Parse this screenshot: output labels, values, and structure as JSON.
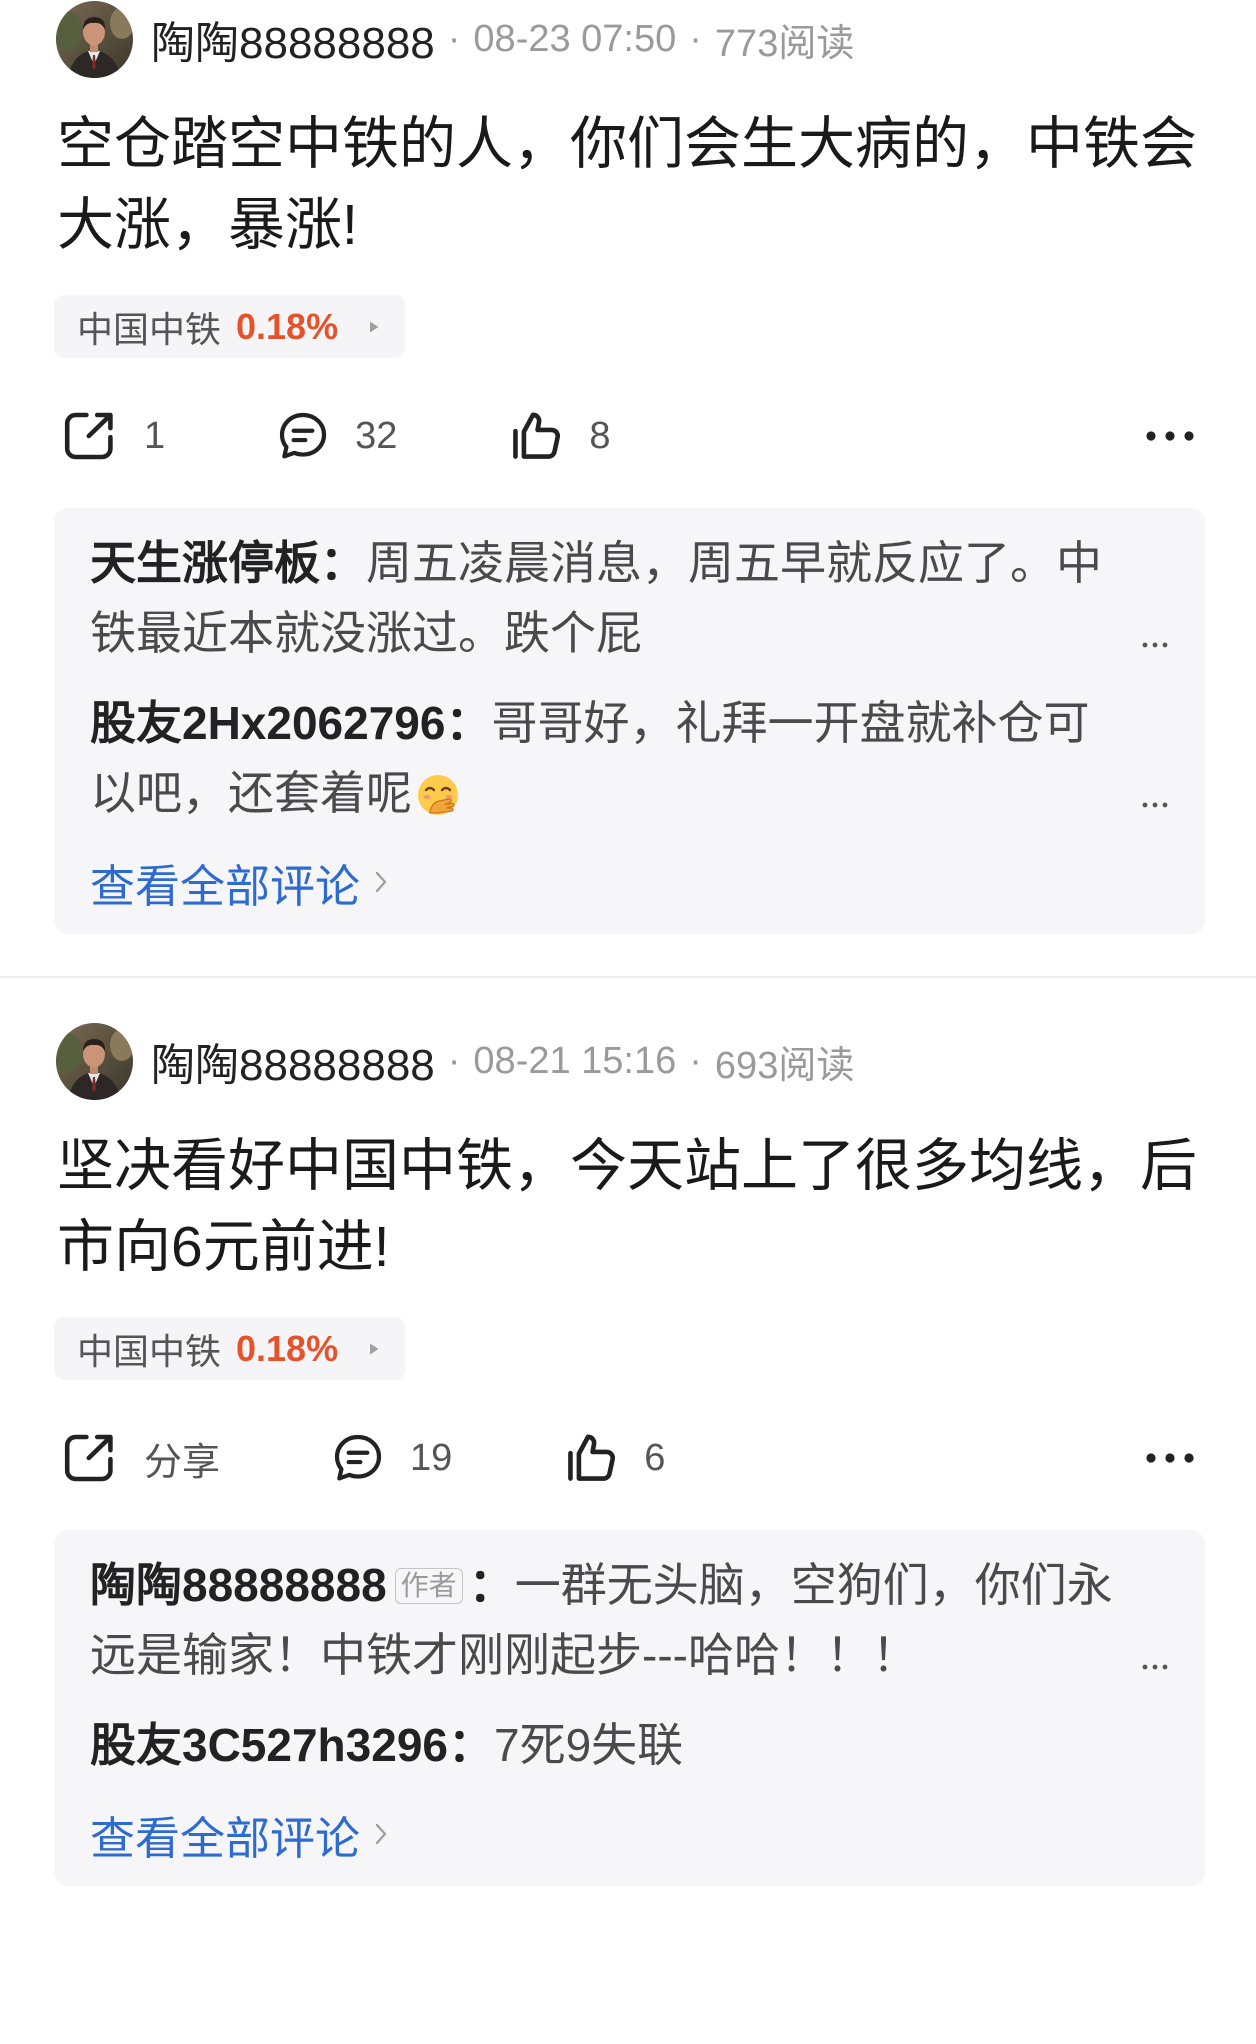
{
  "separator": "·",
  "colon": "：",
  "posts": [
    {
      "author": "陶陶88888888",
      "date": "08-23 07:50",
      "reads": "773阅读",
      "content": "空仓踏空中铁的人，你们会生大病的，中铁会大涨，暴涨!",
      "stock": {
        "name": "中国中铁",
        "change": "0.18%"
      },
      "actions": {
        "share": "1",
        "comments": "32",
        "likes": "8"
      },
      "comments": [
        {
          "user": "天生涨停板",
          "text": "周五凌晨消息，周五早就反应了。中铁最近本就没涨过。跌个屁"
        },
        {
          "user": "股友2Hx2062796",
          "text": "哥哥好，礼拜一开盘就补仓可以吧，还套着呢",
          "emoji_icon": "face-with-hand-over-mouth-icon"
        }
      ],
      "view_all": "查看全部评论"
    },
    {
      "author": "陶陶88888888",
      "date": "08-21 15:16",
      "reads": "693阅读",
      "content": "坚决看好中国中铁，今天站上了很多均线，后市向6元前进!",
      "stock": {
        "name": "中国中铁",
        "change": "0.18%"
      },
      "actions": {
        "share": "分享",
        "comments": "19",
        "likes": "6"
      },
      "comments": [
        {
          "user": "陶陶88888888",
          "badge": "作者",
          "text": "一群无头脑，空狗们，你们永远是输家！中铁才刚刚起步---哈哈！！！"
        },
        {
          "user": "股友3C527h3296",
          "text": "7死9失联"
        }
      ],
      "view_all": "查看全部评论"
    }
  ],
  "icons": {
    "avatar": "avatar",
    "share": "share-icon",
    "comment": "comment-icon",
    "like": "thumbs-up-icon",
    "more": "more-dots-icon",
    "stock_arrow": "caret-right-icon",
    "view_all_arrow": "chevron-right-icon"
  },
  "colors": {
    "text": "#1a1a1a",
    "muted": "#9a9a9a",
    "stock_change": "#e5532d",
    "link": "#2e6bd0",
    "comment_bg": "#f6f6f8",
    "tag_bg": "#f5f5f7"
  }
}
